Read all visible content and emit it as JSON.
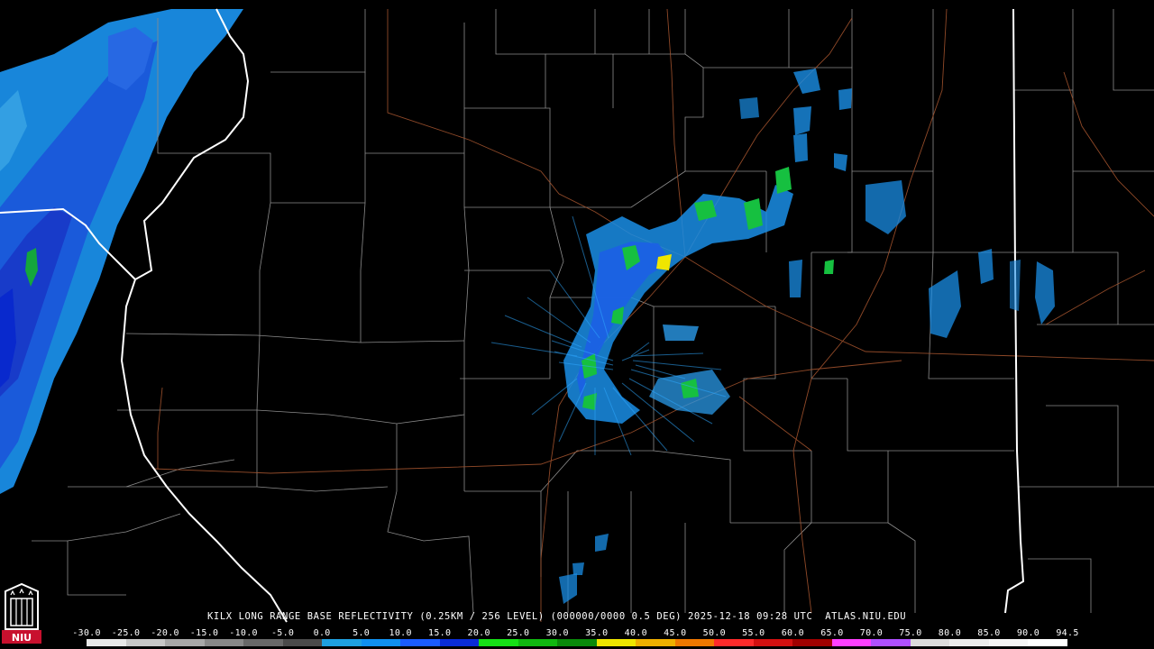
{
  "product": {
    "title": "KILX LONG RANGE BASE REFLECTIVITY (0.25KM / 256 LEVEL) (000000/0000 0.5 DEG) 2025-12-18 09:28 UTC  ATLAS.NIU.EDU"
  },
  "logo": {
    "text": "NIU",
    "icon": "niu-castle-logo-icon",
    "color": "#c8102e"
  },
  "colorbar": {
    "labels": [
      "-30.0",
      "-25.0",
      "-20.0",
      "-15.0",
      "-10.0",
      "-5.0",
      "0.0",
      "5.0",
      "10.0",
      "15.0",
      "20.0",
      "25.0",
      "30.0",
      "35.0",
      "40.0",
      "45.0",
      "50.0",
      "55.0",
      "60.0",
      "65.0",
      "70.0",
      "75.0",
      "80.0",
      "85.0",
      "90.0",
      "94.5"
    ],
    "colors": [
      "#e8e8e8",
      "#c8c8c8",
      "#a8a8a8",
      "#888888",
      "#686868",
      "#4a4a4a",
      "#1fa0e0",
      "#1090f0",
      "#1a5cff",
      "#0a2cd8",
      "#16e016",
      "#10b810",
      "#0a8a0a",
      "#f0e600",
      "#f0b000",
      "#f07800",
      "#ff2a2a",
      "#d41010",
      "#a00000",
      "#ff40ff",
      "#b050ff",
      "#dcdcdc",
      "#ececec",
      "#f6f6f6",
      "#ffffff"
    ]
  },
  "map": {
    "background": "#000000",
    "county_border_color": "#8c8c8c",
    "state_border_color": "#ffffff",
    "highway_color": "#a0522d"
  }
}
